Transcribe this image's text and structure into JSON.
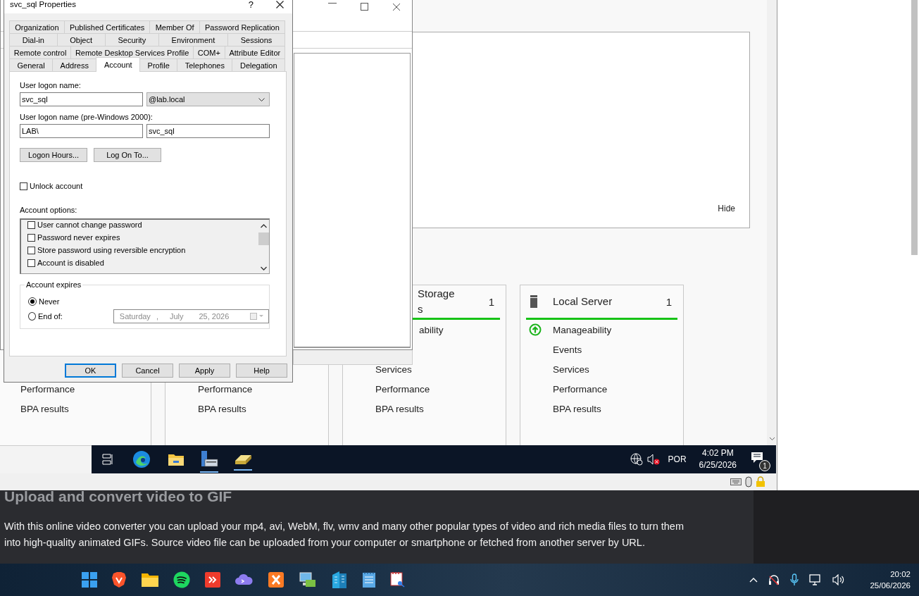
{
  "dialog": {
    "title": "svc_sql Properties",
    "help": "?",
    "tab_rows": [
      [
        {
          "label": "Organization",
          "selected": false
        },
        {
          "label": "Published Certificates",
          "selected": false
        },
        {
          "label": "Member Of",
          "selected": false
        },
        {
          "label": "Password Replication",
          "selected": false
        }
      ],
      [
        {
          "label": "Dial-in",
          "selected": false
        },
        {
          "label": "Object",
          "selected": false
        },
        {
          "label": "Security",
          "selected": false
        },
        {
          "label": "Environment",
          "selected": false
        },
        {
          "label": "Sessions",
          "selected": false
        }
      ],
      [
        {
          "label": "Remote control",
          "selected": false
        },
        {
          "label": "Remote Desktop Services Profile",
          "selected": false
        },
        {
          "label": "COM+",
          "selected": false
        },
        {
          "label": "Attribute Editor",
          "selected": false
        }
      ],
      [
        {
          "label": "General",
          "selected": false
        },
        {
          "label": "Address",
          "selected": false
        },
        {
          "label": "Account",
          "selected": true
        },
        {
          "label": "Profile",
          "selected": false
        },
        {
          "label": "Telephones",
          "selected": false
        },
        {
          "label": "Delegation",
          "selected": false
        }
      ]
    ],
    "logon_label": "User logon name:",
    "logon_name": "svc_sql",
    "domain": "@lab.local",
    "pre2000_label": "User logon name (pre-Windows 2000):",
    "pre2000_domain": "LAB\\",
    "pre2000_name": "svc_sql",
    "logon_buttons": [
      "Logon Hours...",
      "Log On To..."
    ],
    "unlock": {
      "label": "Unlock account",
      "checked": false
    },
    "options_label": "Account options:",
    "options": [
      {
        "label": "User cannot change password",
        "checked": false
      },
      {
        "label": "Password never expires",
        "checked": false
      },
      {
        "label": "Store password using reversible encryption",
        "checked": false
      },
      {
        "label": "Account is disabled",
        "checked": false
      }
    ],
    "expires": {
      "legend": "Account expires",
      "choices": [
        {
          "label": "Never",
          "selected": true
        },
        {
          "label": "End of:",
          "selected": false
        }
      ],
      "date": {
        "weekday": "Saturday",
        "separator": ",",
        "month": "July",
        "day_year": "25, 2026",
        "disabled": true
      }
    },
    "buttons": [
      {
        "label": "OK",
        "default": true
      },
      {
        "label": "Cancel",
        "default": false
      },
      {
        "label": "Apply",
        "default": false
      },
      {
        "label": "Help",
        "default": false
      }
    ]
  },
  "hide_panel": {
    "link": "Hide"
  },
  "tiles": [
    {
      "items": [
        "Performance",
        "BPA results"
      ]
    },
    {
      "items": [
        "Performance",
        "BPA results"
      ]
    },
    {
      "clipped": true,
      "title_lines": [
        "Storage",
        "s"
      ],
      "count": "1",
      "status_row": {
        "text": "ability"
      },
      "items": [
        "Services",
        "Performance",
        "BPA results"
      ]
    },
    {
      "clipped": false,
      "title_lines": [
        "Local Server"
      ],
      "count": "1",
      "status_row": {
        "text": "Manageability",
        "ok": true
      },
      "items": [
        "Events",
        "Services",
        "Performance",
        "BPA results"
      ]
    }
  ],
  "vm_taskbar": {
    "language": "POR",
    "time": "4:02 PM",
    "date": "6/25/2026",
    "notifications": "1"
  },
  "web": {
    "heading": "Upload and convert video to GIF",
    "paragraph": "With this online video converter you can upload your mp4, avi, WebM, flv, wmv and many other popular types of video and rich media files to turn them into high-quality animated GIFs. Source video file can be uploaded from your computer or smartphone or fetched from another server by URL."
  },
  "host_taskbar": {
    "time": "20:02",
    "date": "25/06/2026"
  }
}
